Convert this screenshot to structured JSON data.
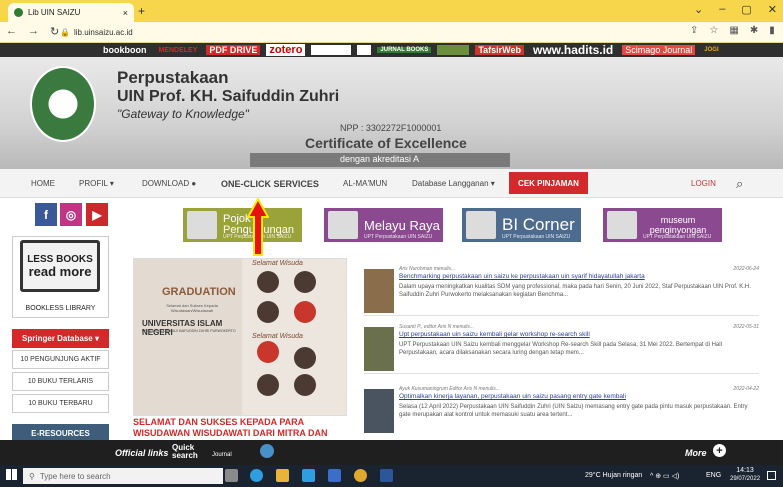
{
  "browser": {
    "tab_title": "Lib UIN SAIZU",
    "url": "lib.uinsaizu.ac.id",
    "new_tab": "+",
    "close": "×"
  },
  "partners": [
    "bookboon",
    "MENDELEY",
    "PDF DRIVE",
    "zotero",
    "",
    "",
    "JURNAL BOOKS",
    "",
    "TafsirWeb",
    "www.hadits.id",
    "Scimago Journal",
    "JOGI"
  ],
  "header": {
    "title1": "Perpustakaan",
    "title2": "UIN Prof. KH. Saifuddin Zuhri",
    "tagline": "\"Gateway to Knowledge\"",
    "npp": "NPP : 3302272F1000001",
    "certificate": "Certificate of Excellence",
    "accreditation": "dengan akreditasi A"
  },
  "menu": {
    "home": "HOME",
    "profil": "PROFIL ▾",
    "download": "DOWNLOAD ●",
    "oneclick": "ONE-CLICK SERVICES",
    "almamun": "AL-MA'MUN",
    "database": "Database Langganan ▾",
    "cek": "CEK PINJAMAN",
    "login": "LOGIN"
  },
  "social": {
    "facebook": "f",
    "instagram": "◎",
    "youtube": "▶"
  },
  "sidebar": {
    "lessbooks1": "LESS BOOKS",
    "lessbooks2": "read more",
    "bookless": "BOOKLESS LIBRARY",
    "springer": "Springer Database ▾",
    "pengunjung": "10 PENGUNJUNG AKTIF",
    "terlaris": "10 BUKU TERLARIS",
    "terbaru": "10 BUKU TERBARU",
    "eresources": "E-RESOURCES"
  },
  "banners": [
    {
      "title": "Pojok Pengunjungan",
      "sub": "UPT Perpustakaan UIN SAIZU",
      "color": "#9aa23a"
    },
    {
      "title": "Melayu Raya",
      "sub": "UPT Perpustakaan UIN SAIZU",
      "color": "#8b4a8f"
    },
    {
      "title": "BI Corner",
      "sub": "UPT Perpustakaan UIN SAIZU",
      "color": "#4d6b8f"
    },
    {
      "title": "museum penginyongan",
      "sub": "UPT Perpustakaan UIN SAIZU",
      "color": "#8b4a8f"
    }
  ],
  "graduation": {
    "heading": "GRADUATION",
    "sub": "Selamat dan Sukses Kepada Wisudawan/Wisudawati",
    "uni": "UNIVERSITAS ISLAM NEGERI",
    "uni2": "PROFESOR KIAI HAJI SAIFUDDIN ZUHRI PURWOKERTO",
    "selamat": "Selamat Wisuda",
    "caption": "SELAMAT DAN SUKSES KEPADA PARA WISUDAWAN WISUDAWATI DARI MITRA DAN DUTA PERPUSTAKAAN"
  },
  "news": [
    {
      "author": "Aris Nurohman menulis...",
      "date": "2022-06-24",
      "title": "Benchmarking perpustakaan uin saizu ke perpustakaan uin syarif hidayatullah jakarta",
      "excerpt": "Dalam upaya meningkatkan kualitas SDM yang professional, maka pada hari Senin, 20 Juni 2022, Staf Perpustakaan UIN Prof. K.H. Saifuddin Zuhri Purwokerto melaksanakan kegiatan Benchma..."
    },
    {
      "author": "Susanti P., editor Aris N menulis...",
      "date": "2022-05-31",
      "title": "Upt perpustakaan uin saizu kembali gelar workshop re-search skill",
      "excerpt": "UPT Perpustakaan UIN Saizu kembali menggelar Workshop Re-search Skill pada Selasa, 31 Mei 2022. Bertempat di Hall Perpustakaan, acara dilaksanakan secara luring dengan tetap mem..."
    },
    {
      "author": "Ayuk Kusumaningrum Editor Aris N menulis...",
      "date": "2022-04-22",
      "title": "Optimalkan kinerja layanan, perpustakaan uin saizu pasang entry gate kembali",
      "excerpt": "Selasa (12 April 2022) Perpustakaan UIN Saifuddin Zuhri (UIN Saizu) memasang entry gate pada pintu masuk perpustakaan. Entry gate merupakan alat kontrol untuk memasuki suatu area tertent..."
    }
  ],
  "officialbar": {
    "official": "Official links",
    "quick": "Quick",
    "search": "search",
    "journal": "Journal",
    "more": "More",
    "plus": "+"
  },
  "taskbar": {
    "search": "Type here to search",
    "weather": "29°C Hujan ringan",
    "lang": "ENG",
    "time": "14:13",
    "date": "29/07/2022"
  }
}
